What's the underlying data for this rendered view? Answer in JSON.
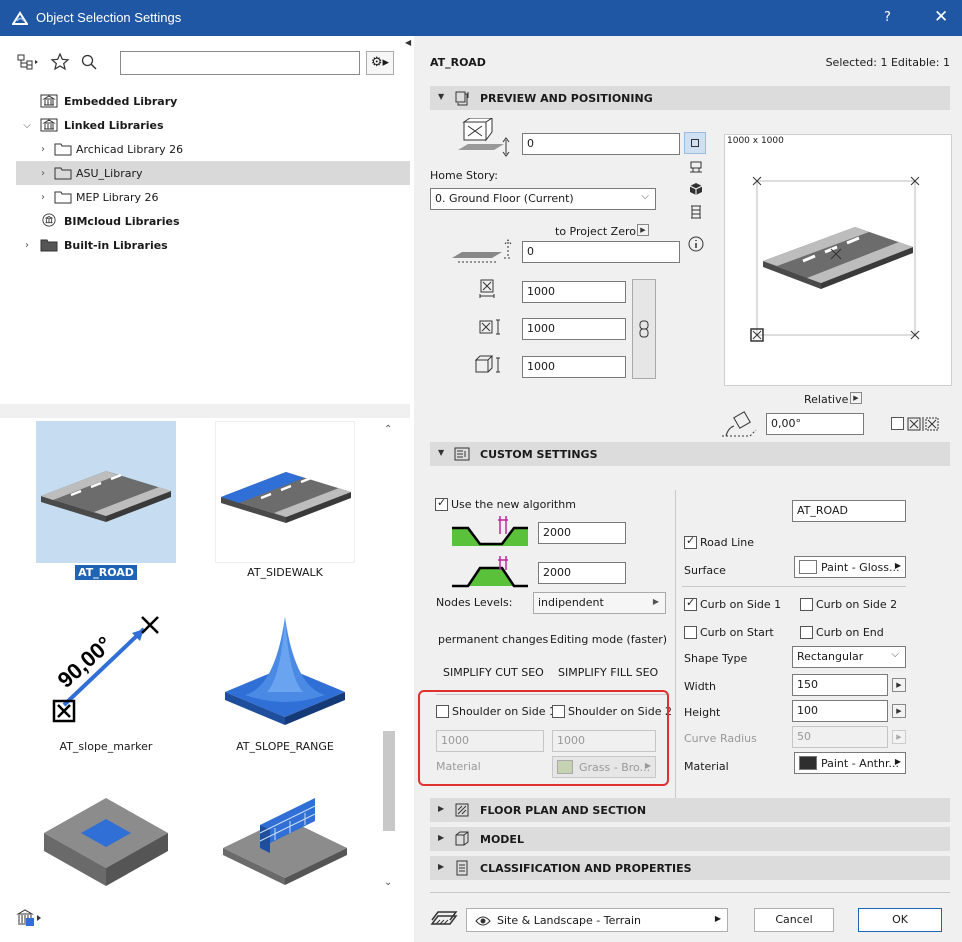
{
  "window": {
    "title": "Object Selection Settings",
    "help": "?",
    "close": "✕"
  },
  "left": {
    "search": {
      "value": "",
      "placeholder": ""
    },
    "tree": [
      {
        "label": "Embedded Library",
        "bold": true
      },
      {
        "label": "Linked Libraries",
        "bold": true
      },
      {
        "label": "Archicad Library 26",
        "bold": false
      },
      {
        "label": "ASU_Library",
        "bold": false,
        "selected": true
      },
      {
        "label": "MEP Library 26",
        "bold": false
      },
      {
        "label": "BIMcloud Libraries",
        "bold": true
      },
      {
        "label": "Built-in Libraries",
        "bold": true
      }
    ],
    "gallery": [
      {
        "label": "AT_ROAD",
        "selected": true
      },
      {
        "label": "AT_SIDEWALK"
      },
      {
        "label": "AT_slope_marker"
      },
      {
        "label": "AT_SLOPE_RANGE"
      },
      {
        "label": ""
      },
      {
        "label": ""
      }
    ],
    "slope_marker_angle": "90,00°"
  },
  "header": {
    "name": "AT_ROAD",
    "selected_info": "Selected: 1 Editable: 1"
  },
  "preview_section": {
    "title": "PREVIEW AND POSITIONING",
    "elevation": "0",
    "home_story_label": "Home Story:",
    "home_story_value": "0. Ground Floor (Current)",
    "to_project_zero": "to Project Zero",
    "project_zero_value": "0",
    "width": "1000",
    "depth": "1000",
    "height": "1000",
    "preview_size": "1000 x 1000",
    "relative_label": "Relative",
    "angle": "0,00°"
  },
  "custom": {
    "title": "CUSTOM SETTINGS",
    "use_new_algorithm": "Use the new algorithm",
    "cut_value": "2000",
    "fill_value": "2000",
    "nodes_levels_label": "Nodes Levels:",
    "nodes_levels_value": "indipendent",
    "permanent_changes": "permanent changes",
    "editing_mode": "Editing mode (faster)",
    "simplify_cut": "SIMPLIFY CUT SEO",
    "simplify_fill": "SIMPLIFY FILL SEO",
    "shoulder_side1": "Shoulder on Side 1",
    "shoulder_side2": "Shoulder on Side 2",
    "shoulder1_value": "1000",
    "shoulder2_value": "1000",
    "material_label": "Material",
    "shoulder_material": "Grass - Bro...",
    "name_value": "AT_ROAD",
    "road_line": "Road Line",
    "surface_label": "Surface",
    "surface_value": "Paint - Gloss...",
    "curb_side1": "Curb on Side 1",
    "curb_side2": "Curb on Side 2",
    "curb_start": "Curb on Start",
    "curb_end": "Curb on End",
    "shape_type_label": "Shape Type",
    "shape_type_value": "Rectangular",
    "width_label": "Width",
    "width_value": "150",
    "height_label": "Height",
    "height_value": "100",
    "curve_radius_label": "Curve Radius",
    "curve_radius_value": "50",
    "material2_label": "Material",
    "material2_value": "Paint - Anthr..."
  },
  "sections": {
    "floor_plan": "FLOOR PLAN AND SECTION",
    "model": "MODEL",
    "classification": "CLASSIFICATION AND PROPERTIES"
  },
  "footer": {
    "layer": "Site & Landscape - Terrain",
    "cancel": "Cancel",
    "ok": "OK"
  },
  "colors": {
    "titlebar": "#1f57a5",
    "accent": "#1e63b4",
    "highlight": "#e03030"
  }
}
